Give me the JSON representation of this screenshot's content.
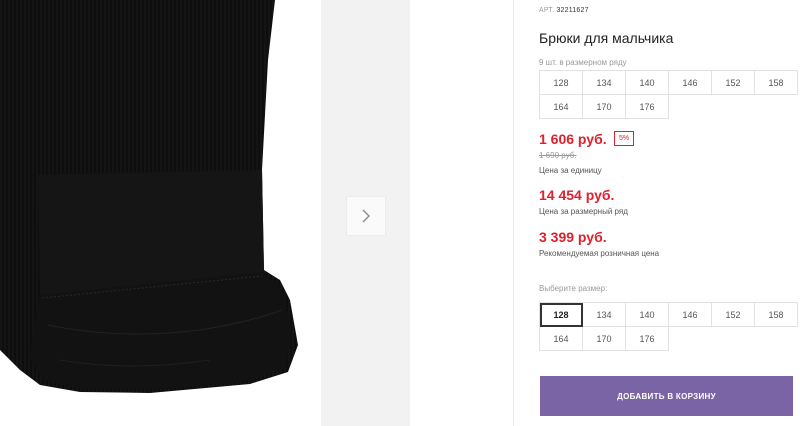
{
  "product": {
    "article_label": "АРТ.",
    "article": "32211627",
    "title": "Брюки для мальчика",
    "sizes_in_row_note": "9 шт. в размерном ряду"
  },
  "size_row": [
    "128",
    "134",
    "140",
    "146",
    "152",
    "158",
    "164",
    "170",
    "176"
  ],
  "prices": {
    "unit_price": "1 606 руб.",
    "discount": "5%",
    "old_price": "1 690 руб.",
    "unit_label": "Цена за единицу",
    "row_price": "14 454 руб.",
    "row_label": "Цена за размерный ряд",
    "rrp_price": "3 399 руб.",
    "rrp_label": "Рекомендуемая розничная цена"
  },
  "size_select": {
    "label": "Выберите размер:",
    "selected": "128",
    "options": [
      "128",
      "134",
      "140",
      "146",
      "152",
      "158",
      "164",
      "170",
      "176"
    ]
  },
  "add_to_cart_label": "ДОБАВИТЬ В КОРЗИНУ",
  "icons": {
    "next": "chevron-right-icon"
  },
  "colors": {
    "accent": "#7a64a6",
    "price": "#e0202c"
  }
}
